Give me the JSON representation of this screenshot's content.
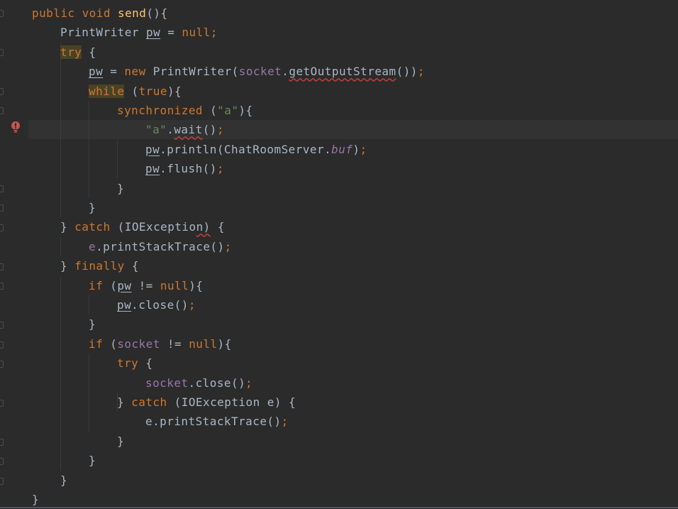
{
  "editor": {
    "language": "java",
    "colors": {
      "background": "#2b2b2b",
      "text": "#a9b7c6",
      "keyword": "#cc7832",
      "function": "#ffc66d",
      "string": "#6a8759",
      "field": "#9876aa",
      "error": "#bc3f3c"
    },
    "gutter_icon": "error-bulb-icon",
    "current_line": 7,
    "lines": [
      {
        "indent": 0,
        "tokens": [
          [
            "kw",
            "public void "
          ],
          [
            "fn",
            "send"
          ],
          [
            "p",
            "(){"
          ]
        ]
      },
      {
        "indent": 1,
        "tokens": [
          [
            "p",
            "PrintWriter "
          ],
          [
            "u",
            "pw"
          ],
          [
            "p",
            " = "
          ],
          [
            "kw",
            "null;"
          ]
        ]
      },
      {
        "indent": 1,
        "tokens": [
          [
            "kwhl",
            "try"
          ],
          [
            "p",
            " {"
          ]
        ]
      },
      {
        "indent": 2,
        "tokens": [
          [
            "u",
            "pw"
          ],
          [
            "p",
            " = "
          ],
          [
            "kw",
            "new "
          ],
          [
            "p",
            "PrintWriter("
          ],
          [
            "fld",
            "socket"
          ],
          [
            "p",
            "."
          ],
          [
            "wavy",
            "getOutputStream"
          ],
          [
            "p",
            "())"
          ],
          [
            "kw",
            ";"
          ]
        ]
      },
      {
        "indent": 2,
        "tokens": [
          [
            "kwhl",
            "while"
          ],
          [
            "p",
            " ("
          ],
          [
            "kw",
            "true"
          ],
          [
            "p",
            "){"
          ]
        ]
      },
      {
        "indent": 3,
        "tokens": [
          [
            "kw",
            "synchronized "
          ],
          [
            "p",
            "("
          ],
          [
            "str",
            "\"a\""
          ],
          [
            "p",
            "){"
          ]
        ]
      },
      {
        "indent": 4,
        "tokens": [
          [
            "str",
            "\"a\""
          ],
          [
            "p",
            "."
          ],
          [
            "wavy",
            "wait"
          ],
          [
            "p",
            "()"
          ],
          [
            "kw",
            ";"
          ]
        ]
      },
      {
        "indent": 4,
        "tokens": [
          [
            "u",
            "pw"
          ],
          [
            "p",
            ".println(ChatRoomServer."
          ],
          [
            "sfld",
            "buf"
          ],
          [
            "p",
            ")"
          ],
          [
            "kw",
            ";"
          ]
        ]
      },
      {
        "indent": 4,
        "tokens": [
          [
            "u",
            "pw"
          ],
          [
            "p",
            ".flush()"
          ],
          [
            "kw",
            ";"
          ]
        ]
      },
      {
        "indent": 3,
        "tokens": [
          [
            "p",
            "}"
          ]
        ]
      },
      {
        "indent": 2,
        "tokens": [
          [
            "p",
            "}"
          ]
        ]
      },
      {
        "indent": 1,
        "tokens": [
          [
            "p",
            "} "
          ],
          [
            "kw",
            "catch "
          ],
          [
            "p",
            "(IOExceptio"
          ],
          [
            "wavy",
            "n)"
          ],
          [
            "p",
            " {"
          ]
        ]
      },
      {
        "indent": 2,
        "tokens": [
          [
            "fld",
            "e"
          ],
          [
            "p",
            ".printStackTrace()"
          ],
          [
            "kw",
            ";"
          ]
        ]
      },
      {
        "indent": 1,
        "tokens": [
          [
            "p",
            "} "
          ],
          [
            "kw",
            "finally "
          ],
          [
            "p",
            "{"
          ]
        ]
      },
      {
        "indent": 2,
        "tokens": [
          [
            "kw",
            "if "
          ],
          [
            "p",
            "("
          ],
          [
            "u",
            "pw"
          ],
          [
            "p",
            " != "
          ],
          [
            "kw",
            "null"
          ],
          [
            "p",
            "){"
          ]
        ]
      },
      {
        "indent": 3,
        "tokens": [
          [
            "u",
            "pw"
          ],
          [
            "p",
            ".close()"
          ],
          [
            "kw",
            ";"
          ]
        ]
      },
      {
        "indent": 2,
        "tokens": [
          [
            "p",
            "}"
          ]
        ]
      },
      {
        "indent": 2,
        "tokens": [
          [
            "kw",
            "if "
          ],
          [
            "p",
            "("
          ],
          [
            "fld",
            "socket"
          ],
          [
            "p",
            " != "
          ],
          [
            "kw",
            "null"
          ],
          [
            "p",
            "){"
          ]
        ]
      },
      {
        "indent": 3,
        "tokens": [
          [
            "kw",
            "try "
          ],
          [
            "p",
            "{"
          ]
        ]
      },
      {
        "indent": 4,
        "tokens": [
          [
            "fld",
            "socket"
          ],
          [
            "p",
            ".close()"
          ],
          [
            "kw",
            ";"
          ]
        ]
      },
      {
        "indent": 3,
        "tokens": [
          [
            "p",
            "} "
          ],
          [
            "kw",
            "catch "
          ],
          [
            "p",
            "(IOException e) {"
          ]
        ]
      },
      {
        "indent": 4,
        "tokens": [
          [
            "p",
            "e.printStackTrace()"
          ],
          [
            "kw",
            ";"
          ]
        ]
      },
      {
        "indent": 3,
        "tokens": [
          [
            "p",
            "}"
          ]
        ]
      },
      {
        "indent": 2,
        "tokens": [
          [
            "p",
            "}"
          ]
        ]
      },
      {
        "indent": 1,
        "tokens": [
          [
            "p",
            "}"
          ]
        ]
      },
      {
        "indent": 0,
        "tokens": [
          [
            "p",
            "}"
          ]
        ]
      }
    ]
  }
}
